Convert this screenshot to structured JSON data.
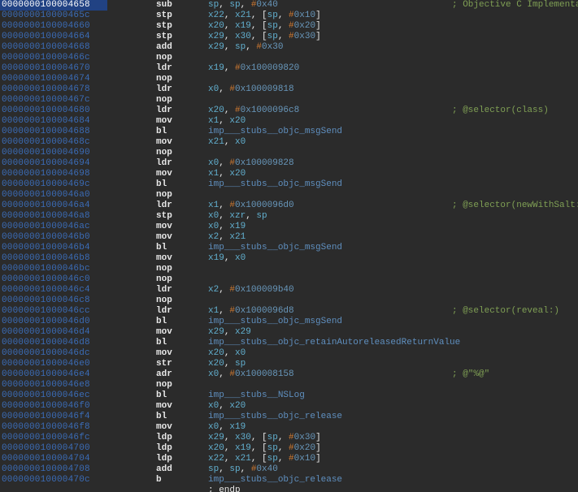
{
  "chart_data": null,
  "colors": {
    "background": "#2b2b2b",
    "address": "#3b6cb7",
    "mnemonic": "#e8e8e8",
    "register": "#62b0d0",
    "immediate_prefix": "#cc7832",
    "immediate_value": "#6897bb",
    "comment": "#7f9f54",
    "label": "#5f8fbf",
    "selection": "#214283"
  },
  "lines": [
    {
      "addr": "0000000100004658",
      "mn": "sub",
      "ops": [
        {
          "t": "reg",
          "v": "sp"
        },
        {
          "t": "p",
          "v": ", "
        },
        {
          "t": "reg",
          "v": "sp"
        },
        {
          "t": "p",
          "v": ", "
        },
        {
          "t": "num",
          "v": "#"
        },
        {
          "t": "imm",
          "v": "0x40"
        }
      ],
      "cm": "; Objective C Implementati",
      "sel": true
    },
    {
      "addr": "000000010000465c",
      "mn": "stp",
      "ops": [
        {
          "t": "reg",
          "v": "x22"
        },
        {
          "t": "p",
          "v": ", "
        },
        {
          "t": "reg",
          "v": "x21"
        },
        {
          "t": "p",
          "v": ", ["
        },
        {
          "t": "reg",
          "v": "sp"
        },
        {
          "t": "p",
          "v": ", "
        },
        {
          "t": "num",
          "v": "#"
        },
        {
          "t": "imm",
          "v": "0x10"
        },
        {
          "t": "p",
          "v": "]"
        }
      ]
    },
    {
      "addr": "0000000100004660",
      "mn": "stp",
      "ops": [
        {
          "t": "reg",
          "v": "x20"
        },
        {
          "t": "p",
          "v": ", "
        },
        {
          "t": "reg",
          "v": "x19"
        },
        {
          "t": "p",
          "v": ", ["
        },
        {
          "t": "reg",
          "v": "sp"
        },
        {
          "t": "p",
          "v": ", "
        },
        {
          "t": "num",
          "v": "#"
        },
        {
          "t": "imm",
          "v": "0x20"
        },
        {
          "t": "p",
          "v": "]"
        }
      ]
    },
    {
      "addr": "0000000100004664",
      "mn": "stp",
      "ops": [
        {
          "t": "reg",
          "v": "x29"
        },
        {
          "t": "p",
          "v": ", "
        },
        {
          "t": "reg",
          "v": "x30"
        },
        {
          "t": "p",
          "v": ", ["
        },
        {
          "t": "reg",
          "v": "sp"
        },
        {
          "t": "p",
          "v": ", "
        },
        {
          "t": "num",
          "v": "#"
        },
        {
          "t": "imm",
          "v": "0x30"
        },
        {
          "t": "p",
          "v": "]"
        }
      ]
    },
    {
      "addr": "0000000100004668",
      "mn": "add",
      "ops": [
        {
          "t": "reg",
          "v": "x29"
        },
        {
          "t": "p",
          "v": ", "
        },
        {
          "t": "reg",
          "v": "sp"
        },
        {
          "t": "p",
          "v": ", "
        },
        {
          "t": "num",
          "v": "#"
        },
        {
          "t": "imm",
          "v": "0x30"
        }
      ]
    },
    {
      "addr": "000000010000466c",
      "mn": "nop",
      "ops": []
    },
    {
      "addr": "0000000100004670",
      "mn": "ldr",
      "ops": [
        {
          "t": "reg",
          "v": "x19"
        },
        {
          "t": "p",
          "v": ", "
        },
        {
          "t": "num",
          "v": "#"
        },
        {
          "t": "imm",
          "v": "0x100009820"
        }
      ]
    },
    {
      "addr": "0000000100004674",
      "mn": "nop",
      "ops": []
    },
    {
      "addr": "0000000100004678",
      "mn": "ldr",
      "ops": [
        {
          "t": "reg",
          "v": "x0"
        },
        {
          "t": "p",
          "v": ", "
        },
        {
          "t": "num",
          "v": "#"
        },
        {
          "t": "imm",
          "v": "0x100009818"
        }
      ]
    },
    {
      "addr": "000000010000467c",
      "mn": "nop",
      "ops": []
    },
    {
      "addr": "0000000100004680",
      "mn": "ldr",
      "ops": [
        {
          "t": "reg",
          "v": "x20"
        },
        {
          "t": "p",
          "v": ", "
        },
        {
          "t": "num",
          "v": "#"
        },
        {
          "t": "imm",
          "v": "0x1000096c8"
        }
      ],
      "cm": "; @selector(class)"
    },
    {
      "addr": "0000000100004684",
      "mn": "mov",
      "ops": [
        {
          "t": "reg",
          "v": "x1"
        },
        {
          "t": "p",
          "v": ", "
        },
        {
          "t": "reg",
          "v": "x20"
        }
      ]
    },
    {
      "addr": "0000000100004688",
      "mn": "bl",
      "ops": [
        {
          "t": "lbl",
          "v": "imp___stubs__objc_msgSend"
        }
      ]
    },
    {
      "addr": "000000010000468c",
      "mn": "mov",
      "ops": [
        {
          "t": "reg",
          "v": "x21"
        },
        {
          "t": "p",
          "v": ", "
        },
        {
          "t": "reg",
          "v": "x0"
        }
      ]
    },
    {
      "addr": "0000000100004690",
      "mn": "nop",
      "ops": []
    },
    {
      "addr": "0000000100004694",
      "mn": "ldr",
      "ops": [
        {
          "t": "reg",
          "v": "x0"
        },
        {
          "t": "p",
          "v": ", "
        },
        {
          "t": "num",
          "v": "#"
        },
        {
          "t": "imm",
          "v": "0x100009828"
        }
      ]
    },
    {
      "addr": "0000000100004698",
      "mn": "mov",
      "ops": [
        {
          "t": "reg",
          "v": "x1"
        },
        {
          "t": "p",
          "v": ", "
        },
        {
          "t": "reg",
          "v": "x20"
        }
      ]
    },
    {
      "addr": "000000010000469c",
      "mn": "bl",
      "ops": [
        {
          "t": "lbl",
          "v": "imp___stubs__objc_msgSend"
        }
      ]
    },
    {
      "addr": "00000001000046a0",
      "mn": "nop",
      "ops": []
    },
    {
      "addr": "00000001000046a4",
      "mn": "ldr",
      "ops": [
        {
          "t": "reg",
          "v": "x1"
        },
        {
          "t": "p",
          "v": ", "
        },
        {
          "t": "num",
          "v": "#"
        },
        {
          "t": "imm",
          "v": "0x1000096d0"
        }
      ],
      "cm": "; @selector(newWithSalt:)"
    },
    {
      "addr": "00000001000046a8",
      "mn": "stp",
      "ops": [
        {
          "t": "reg",
          "v": "x0"
        },
        {
          "t": "p",
          "v": ", "
        },
        {
          "t": "reg",
          "v": "xzr"
        },
        {
          "t": "p",
          "v": ", "
        },
        {
          "t": "reg",
          "v": "sp"
        }
      ]
    },
    {
      "addr": "00000001000046ac",
      "mn": "mov",
      "ops": [
        {
          "t": "reg",
          "v": "x0"
        },
        {
          "t": "p",
          "v": ", "
        },
        {
          "t": "reg",
          "v": "x19"
        }
      ]
    },
    {
      "addr": "00000001000046b0",
      "mn": "mov",
      "ops": [
        {
          "t": "reg",
          "v": "x2"
        },
        {
          "t": "p",
          "v": ", "
        },
        {
          "t": "reg",
          "v": "x21"
        }
      ]
    },
    {
      "addr": "00000001000046b4",
      "mn": "bl",
      "ops": [
        {
          "t": "lbl",
          "v": "imp___stubs__objc_msgSend"
        }
      ]
    },
    {
      "addr": "00000001000046b8",
      "mn": "mov",
      "ops": [
        {
          "t": "reg",
          "v": "x19"
        },
        {
          "t": "p",
          "v": ", "
        },
        {
          "t": "reg",
          "v": "x0"
        }
      ]
    },
    {
      "addr": "00000001000046bc",
      "mn": "nop",
      "ops": []
    },
    {
      "addr": "00000001000046c0",
      "mn": "nop",
      "ops": []
    },
    {
      "addr": "00000001000046c4",
      "mn": "ldr",
      "ops": [
        {
          "t": "reg",
          "v": "x2"
        },
        {
          "t": "p",
          "v": ", "
        },
        {
          "t": "num",
          "v": "#"
        },
        {
          "t": "imm",
          "v": "0x100009b40"
        }
      ]
    },
    {
      "addr": "00000001000046c8",
      "mn": "nop",
      "ops": []
    },
    {
      "addr": "00000001000046cc",
      "mn": "ldr",
      "ops": [
        {
          "t": "reg",
          "v": "x1"
        },
        {
          "t": "p",
          "v": ", "
        },
        {
          "t": "num",
          "v": "#"
        },
        {
          "t": "imm",
          "v": "0x1000096d8"
        }
      ],
      "cm": "; @selector(reveal:)"
    },
    {
      "addr": "00000001000046d0",
      "mn": "bl",
      "ops": [
        {
          "t": "lbl",
          "v": "imp___stubs__objc_msgSend"
        }
      ]
    },
    {
      "addr": "00000001000046d4",
      "mn": "mov",
      "ops": [
        {
          "t": "reg",
          "v": "x29"
        },
        {
          "t": "p",
          "v": ", "
        },
        {
          "t": "reg",
          "v": "x29"
        }
      ]
    },
    {
      "addr": "00000001000046d8",
      "mn": "bl",
      "ops": [
        {
          "t": "lbl",
          "v": "imp___stubs__objc_retainAutoreleasedReturnValue"
        }
      ]
    },
    {
      "addr": "00000001000046dc",
      "mn": "mov",
      "ops": [
        {
          "t": "reg",
          "v": "x20"
        },
        {
          "t": "p",
          "v": ", "
        },
        {
          "t": "reg",
          "v": "x0"
        }
      ]
    },
    {
      "addr": "00000001000046e0",
      "mn": "str",
      "ops": [
        {
          "t": "reg",
          "v": "x20"
        },
        {
          "t": "p",
          "v": ", "
        },
        {
          "t": "reg",
          "v": "sp"
        }
      ]
    },
    {
      "addr": "00000001000046e4",
      "mn": "adr",
      "ops": [
        {
          "t": "reg",
          "v": "x0"
        },
        {
          "t": "p",
          "v": ", "
        },
        {
          "t": "num",
          "v": "#"
        },
        {
          "t": "imm",
          "v": "0x100008158"
        }
      ],
      "cm": "; @\"%@\""
    },
    {
      "addr": "00000001000046e8",
      "mn": "nop",
      "ops": []
    },
    {
      "addr": "00000001000046ec",
      "mn": "bl",
      "ops": [
        {
          "t": "lbl",
          "v": "imp___stubs__NSLog"
        }
      ]
    },
    {
      "addr": "00000001000046f0",
      "mn": "mov",
      "ops": [
        {
          "t": "reg",
          "v": "x0"
        },
        {
          "t": "p",
          "v": ", "
        },
        {
          "t": "reg",
          "v": "x20"
        }
      ]
    },
    {
      "addr": "00000001000046f4",
      "mn": "bl",
      "ops": [
        {
          "t": "lbl",
          "v": "imp___stubs__objc_release"
        }
      ]
    },
    {
      "addr": "00000001000046f8",
      "mn": "mov",
      "ops": [
        {
          "t": "reg",
          "v": "x0"
        },
        {
          "t": "p",
          "v": ", "
        },
        {
          "t": "reg",
          "v": "x19"
        }
      ]
    },
    {
      "addr": "00000001000046fc",
      "mn": "ldp",
      "ops": [
        {
          "t": "reg",
          "v": "x29"
        },
        {
          "t": "p",
          "v": ", "
        },
        {
          "t": "reg",
          "v": "x30"
        },
        {
          "t": "p",
          "v": ", ["
        },
        {
          "t": "reg",
          "v": "sp"
        },
        {
          "t": "p",
          "v": ", "
        },
        {
          "t": "num",
          "v": "#"
        },
        {
          "t": "imm",
          "v": "0x30"
        },
        {
          "t": "p",
          "v": "]"
        }
      ]
    },
    {
      "addr": "0000000100004700",
      "mn": "ldp",
      "ops": [
        {
          "t": "reg",
          "v": "x20"
        },
        {
          "t": "p",
          "v": ", "
        },
        {
          "t": "reg",
          "v": "x19"
        },
        {
          "t": "p",
          "v": ", ["
        },
        {
          "t": "reg",
          "v": "sp"
        },
        {
          "t": "p",
          "v": ", "
        },
        {
          "t": "num",
          "v": "#"
        },
        {
          "t": "imm",
          "v": "0x20"
        },
        {
          "t": "p",
          "v": "]"
        }
      ]
    },
    {
      "addr": "0000000100004704",
      "mn": "ldp",
      "ops": [
        {
          "t": "reg",
          "v": "x22"
        },
        {
          "t": "p",
          "v": ", "
        },
        {
          "t": "reg",
          "v": "x21"
        },
        {
          "t": "p",
          "v": ", ["
        },
        {
          "t": "reg",
          "v": "sp"
        },
        {
          "t": "p",
          "v": ", "
        },
        {
          "t": "num",
          "v": "#"
        },
        {
          "t": "imm",
          "v": "0x10"
        },
        {
          "t": "p",
          "v": "]"
        }
      ]
    },
    {
      "addr": "0000000100004708",
      "mn": "add",
      "ops": [
        {
          "t": "reg",
          "v": "sp"
        },
        {
          "t": "p",
          "v": ", "
        },
        {
          "t": "reg",
          "v": "sp"
        },
        {
          "t": "p",
          "v": ", "
        },
        {
          "t": "num",
          "v": "#"
        },
        {
          "t": "imm",
          "v": "0x40"
        }
      ]
    },
    {
      "addr": "000000010000470c",
      "mn": "b",
      "ops": [
        {
          "t": "lbl",
          "v": "imp___stubs__objc_release"
        }
      ]
    },
    {
      "addr": "",
      "mn": "",
      "ops": [
        {
          "t": "p",
          "v": "; endp"
        }
      ]
    }
  ]
}
